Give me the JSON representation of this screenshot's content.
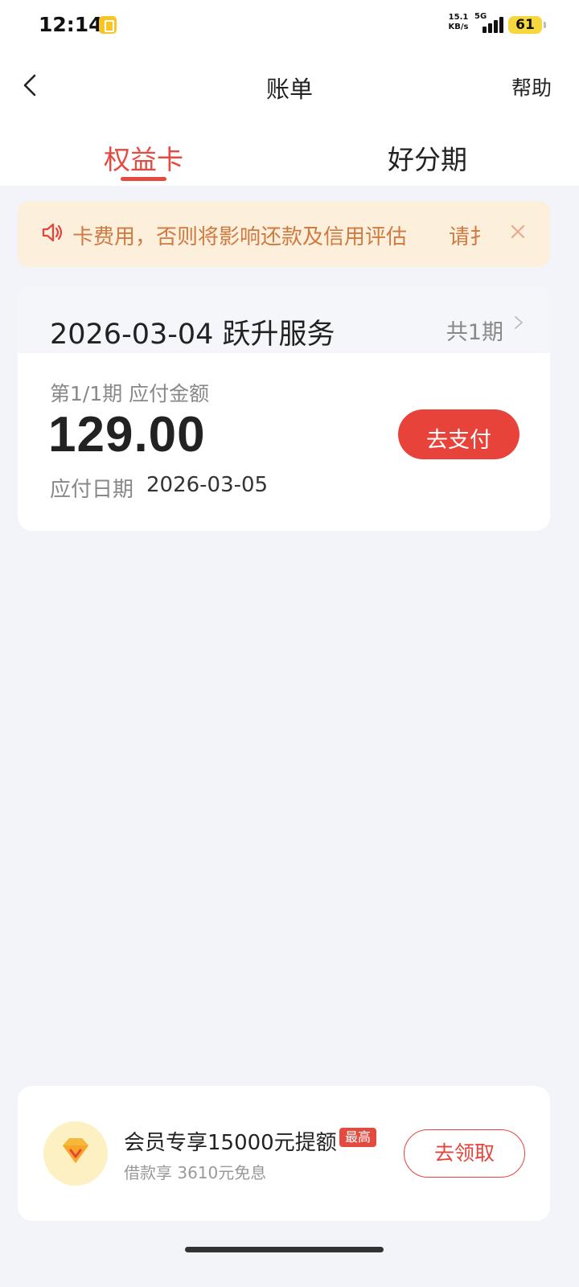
{
  "status_bar": {
    "time": "12:14",
    "net_speed_value": "15.1",
    "net_speed_unit": "KB/s",
    "network_type": "5G",
    "battery": "61"
  },
  "nav": {
    "title": "账单",
    "help": "帮助"
  },
  "tabs": [
    {
      "label": "权益卡",
      "active": true
    },
    {
      "label": "好分期",
      "active": false
    }
  ],
  "notice": {
    "text": "卡费用，否则将影响还款及信用评估　　请扌",
    "color": "#cf7a40"
  },
  "bill": {
    "title": "2026-03-04 跃升服务",
    "periods": "共1期",
    "label": "第1/1期 应付金额",
    "amount": "129.00",
    "date_label": "应付日期",
    "date_value": "2026-03-05",
    "pay_button": "去支付"
  },
  "promo": {
    "title": "会员专享15000元提额",
    "badge": "最高",
    "subtitle": "借款享 3610元免息",
    "claim_button": "去领取"
  },
  "colors": {
    "accent": "#e44a3f",
    "background": "#f3f4f9"
  }
}
